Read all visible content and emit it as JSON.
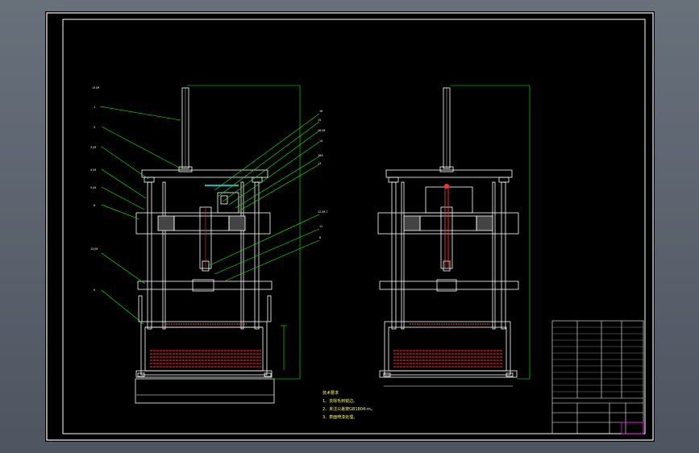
{
  "drawing": {
    "background_color": "#000000",
    "frame_color": "#ffffff",
    "line_colors": {
      "machine": "#ffffff",
      "leader": "#00ff00",
      "hidden": "#ff3333",
      "accent": "#00ffff",
      "notes": "#ffff55",
      "highlight": "#ff00ff"
    }
  },
  "notes": {
    "title": "技术要求",
    "lines": [
      "1、去除毛刺锐边。",
      "2、未注公差按GB1804-m。",
      "3、表面喷漆处理。"
    ]
  }
}
